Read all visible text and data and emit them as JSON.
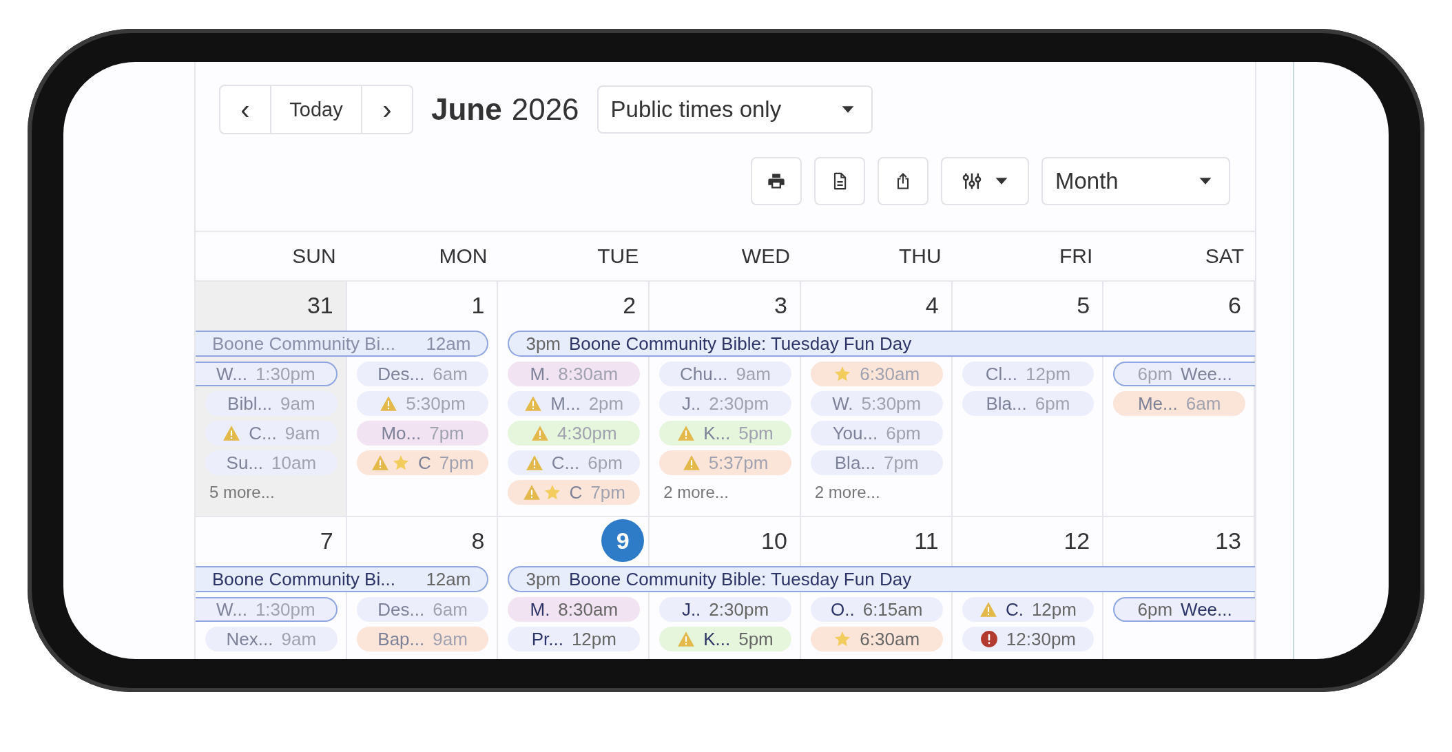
{
  "toolbar": {
    "prev": "‹",
    "today": "Today",
    "next": "›",
    "month": "June",
    "year": "2026",
    "filter": "Public times only",
    "view": "Month"
  },
  "weekdays": [
    "SUN",
    "MON",
    "TUE",
    "WED",
    "THU",
    "FRI",
    "SAT"
  ],
  "weeks": [
    {
      "days": [
        {
          "number": "31",
          "other_month": true,
          "today": false,
          "span": {
            "title": "Boone Community Bi...",
            "time": "12am",
            "time_first": false,
            "open_left": true,
            "open_right": false,
            "faded": true
          },
          "events": [
            {
              "kind": "from-left",
              "label": "W...",
              "time": "1:30pm",
              "color": "#eceffb",
              "faded": true
            },
            {
              "kind": "pill",
              "label": "Bibl...",
              "time": "9am",
              "color": "#eceffb",
              "faded": true
            },
            {
              "kind": "pill",
              "label": "C...",
              "time": "9am",
              "color": "#eceffb",
              "faded": true,
              "warning": true
            },
            {
              "kind": "pill",
              "label": "Su...",
              "time": "10am",
              "color": "#eceffb",
              "faded": true
            }
          ],
          "more": "5 more..."
        },
        {
          "number": "1",
          "other_month": false,
          "today": false,
          "span_continues": true,
          "events": [
            {
              "kind": "pill",
              "label": "Des...",
              "time": "6am",
              "color": "#eceffb",
              "faded": true
            },
            {
              "kind": "pill",
              "time": "5:30pm",
              "color": "#eceffb",
              "faded": true,
              "warning": true
            },
            {
              "kind": "pill",
              "label": "Mo...",
              "time": "7pm",
              "color": "#f1e3f1",
              "faded": true
            },
            {
              "kind": "pill",
              "label": "C",
              "time": "7pm",
              "color": "#fbe5d9",
              "faded": true,
              "warning": true,
              "star": true
            }
          ]
        },
        {
          "number": "2",
          "other_month": false,
          "today": false,
          "span": {
            "title": "Boone Community Bible: Tuesday Fun Day",
            "time": "3pm",
            "time_first": true,
            "open_left": false,
            "open_right": true,
            "faded": false
          },
          "events": [
            {
              "kind": "pill",
              "label": "M.",
              "time": "8:30am",
              "color": "#f1e3f1",
              "faded": true
            },
            {
              "kind": "pill",
              "label": "M...",
              "time": "2pm",
              "color": "#eceffb",
              "faded": true,
              "warning": true
            },
            {
              "kind": "pill",
              "time": "4:30pm",
              "color": "#e5f6dc",
              "faded": true,
              "warning": true
            },
            {
              "kind": "pill",
              "label": "C...",
              "time": "6pm",
              "color": "#eceffb",
              "faded": true,
              "warning": true
            },
            {
              "kind": "pill",
              "label": "C",
              "time": "7pm",
              "color": "#fbe5d9",
              "faded": true,
              "warning": true,
              "star": true
            }
          ]
        },
        {
          "number": "3",
          "other_month": false,
          "today": false,
          "span_continues": true,
          "events": [
            {
              "kind": "pill",
              "label": "Chu...",
              "time": "9am",
              "color": "#eceffb",
              "faded": true
            },
            {
              "kind": "pill",
              "label": "J..",
              "time": "2:30pm",
              "color": "#eceffb",
              "faded": true
            },
            {
              "kind": "pill",
              "label": "K...",
              "time": "5pm",
              "color": "#e5f6dc",
              "faded": true,
              "warning": true
            },
            {
              "kind": "pill",
              "time": "5:37pm",
              "color": "#fbe5d9",
              "faded": true,
              "warning": true
            }
          ],
          "more": "2 more..."
        },
        {
          "number": "4",
          "other_month": false,
          "today": false,
          "span_continues": true,
          "events": [
            {
              "kind": "pill",
              "time": "6:30am",
              "color": "#fbe5d9",
              "faded": true,
              "star": true
            },
            {
              "kind": "pill",
              "label": "W.",
              "time": "5:30pm",
              "color": "#eceffb",
              "faded": true
            },
            {
              "kind": "pill",
              "label": "You...",
              "time": "6pm",
              "color": "#eceffb",
              "faded": true
            },
            {
              "kind": "pill",
              "label": "Bla...",
              "time": "7pm",
              "color": "#eceffb",
              "faded": true
            }
          ],
          "more": "2 more..."
        },
        {
          "number": "5",
          "other_month": false,
          "today": false,
          "span_continues": true,
          "events": [
            {
              "kind": "pill",
              "label": "Cl...",
              "time": "12pm",
              "color": "#eceffb",
              "faded": true
            },
            {
              "kind": "pill",
              "label": "Bla...",
              "time": "6pm",
              "color": "#eceffb",
              "faded": true
            }
          ]
        },
        {
          "number": "6",
          "other_month": false,
          "today": false,
          "span_continues": true,
          "events": [
            {
              "kind": "to-right",
              "label": "Wee...",
              "time": "6pm",
              "color": "#eceffb",
              "faded": true
            },
            {
              "kind": "pill",
              "label": "Me...",
              "time": "6am",
              "color": "#fbe5d9",
              "faded": true
            }
          ]
        }
      ]
    },
    {
      "days": [
        {
          "number": "7",
          "other_month": false,
          "today": false,
          "span": {
            "title": "Boone Community Bi...",
            "time": "12am",
            "time_first": false,
            "open_left": true,
            "open_right": false,
            "faded": false
          },
          "events": [
            {
              "kind": "from-left",
              "label": "W...",
              "time": "1:30pm",
              "color": "#eceffb",
              "faded": true
            },
            {
              "kind": "pill",
              "label": "Nex...",
              "time": "9am",
              "color": "#eceffb",
              "faded": true
            }
          ]
        },
        {
          "number": "8",
          "other_month": false,
          "today": false,
          "span_continues": true,
          "events": [
            {
              "kind": "pill",
              "label": "Des...",
              "time": "6am",
              "color": "#eceffb",
              "faded": true
            },
            {
              "kind": "pill",
              "label": "Bap...",
              "time": "9am",
              "color": "#fbe5d9",
              "faded": true
            }
          ]
        },
        {
          "number": "9",
          "other_month": false,
          "today": true,
          "span": {
            "title": "Boone Community Bible: Tuesday Fun Day",
            "time": "3pm",
            "time_first": true,
            "open_left": false,
            "open_right": true,
            "faded": false
          },
          "events": [
            {
              "kind": "pill",
              "label": "M.",
              "time": "8:30am",
              "color": "#f1e3f1",
              "faded": false
            },
            {
              "kind": "pill",
              "label": "Pr...",
              "time": "12pm",
              "color": "#eceffb",
              "faded": false
            }
          ]
        },
        {
          "number": "10",
          "other_month": false,
          "today": false,
          "span_continues": true,
          "events": [
            {
              "kind": "pill",
              "label": "J..",
              "time": "2:30pm",
              "color": "#eceffb",
              "faded": false
            },
            {
              "kind": "pill",
              "label": "K...",
              "time": "5pm",
              "color": "#e5f6dc",
              "faded": false,
              "warning": true
            }
          ]
        },
        {
          "number": "11",
          "other_month": false,
          "today": false,
          "span_continues": true,
          "events": [
            {
              "kind": "pill",
              "label": "O..",
              "time": "6:15am",
              "color": "#eceffb",
              "faded": false
            },
            {
              "kind": "pill",
              "time": "6:30am",
              "color": "#fbe5d9",
              "faded": false,
              "star": true
            }
          ]
        },
        {
          "number": "12",
          "other_month": false,
          "today": false,
          "span_continues": true,
          "events": [
            {
              "kind": "pill",
              "label": "C.",
              "time": "12pm",
              "color": "#eceffb",
              "faded": false,
              "warning": true
            },
            {
              "kind": "pill",
              "time": "12:30pm",
              "color": "#eceffb",
              "faded": false,
              "alert": true
            }
          ]
        },
        {
          "number": "13",
          "other_month": false,
          "today": false,
          "span_continues": true,
          "events": [
            {
              "kind": "to-right",
              "label": "Wee...",
              "time": "6pm",
              "color": "#eceffb",
              "faded": false
            }
          ]
        }
      ]
    }
  ]
}
